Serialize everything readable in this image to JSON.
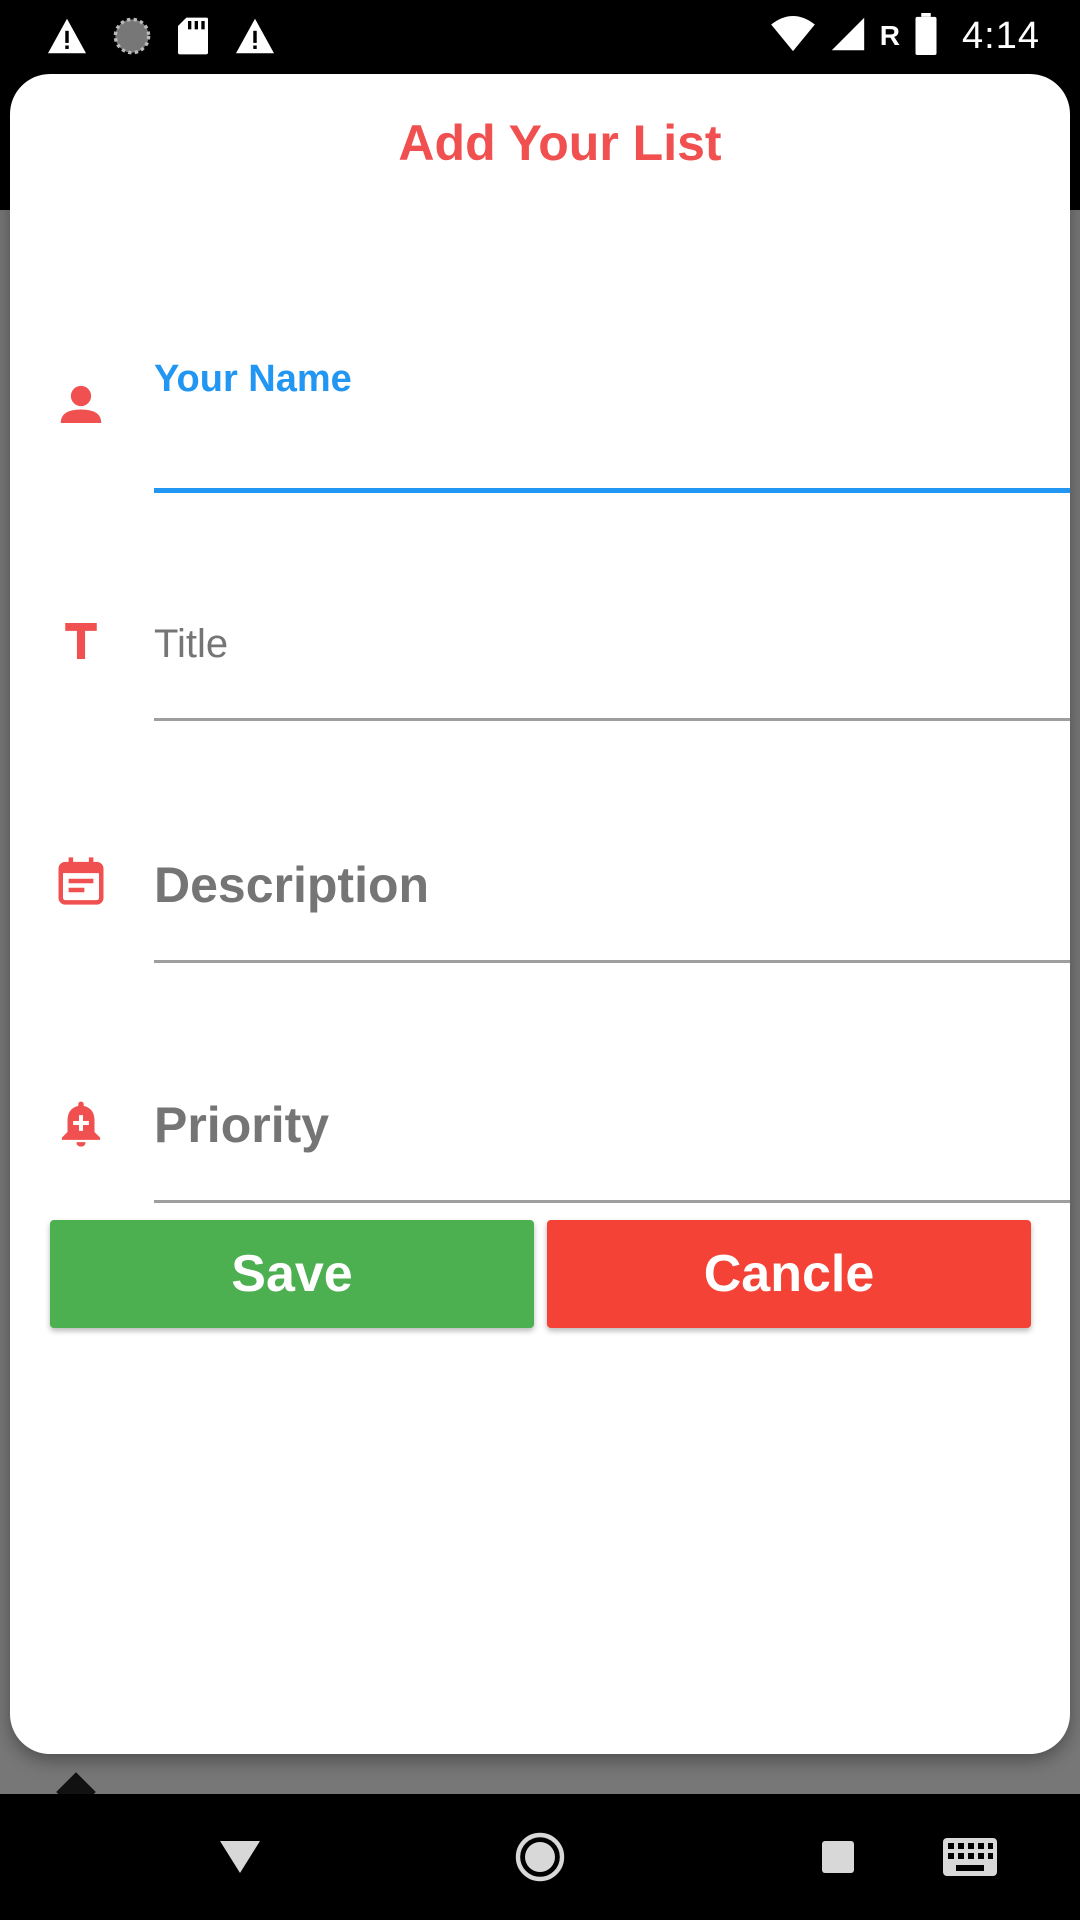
{
  "status_bar": {
    "icons_left": [
      "warning-icon",
      "sync-icon",
      "sd-card-icon",
      "warning-icon"
    ],
    "icons_right": [
      "wifi-icon",
      "cell-signal-icon",
      "battery-icon"
    ],
    "roaming_label": "R",
    "time": "4:14"
  },
  "dialog": {
    "title": "Add Your List",
    "fields": {
      "name": {
        "label": "Your Name",
        "icon": "person-icon",
        "value": ""
      },
      "title": {
        "placeholder": "Title",
        "icon": "text-title-icon",
        "value": ""
      },
      "description": {
        "placeholder": "Description",
        "icon": "calendar-note-icon",
        "value": ""
      },
      "priority": {
        "placeholder": "Priority",
        "icon": "bell-plus-icon",
        "value": ""
      }
    },
    "buttons": {
      "save": "Save",
      "cancel": "Cancle"
    }
  },
  "colors": {
    "title": "#f0504f",
    "icon": "#f0504f",
    "focus": "#2196f3",
    "save_button": "#4caf50",
    "cancel_button": "#f44336"
  },
  "nav_bar": {
    "buttons": [
      "back-icon",
      "home-icon",
      "recents-icon",
      "keyboard-icon"
    ]
  }
}
